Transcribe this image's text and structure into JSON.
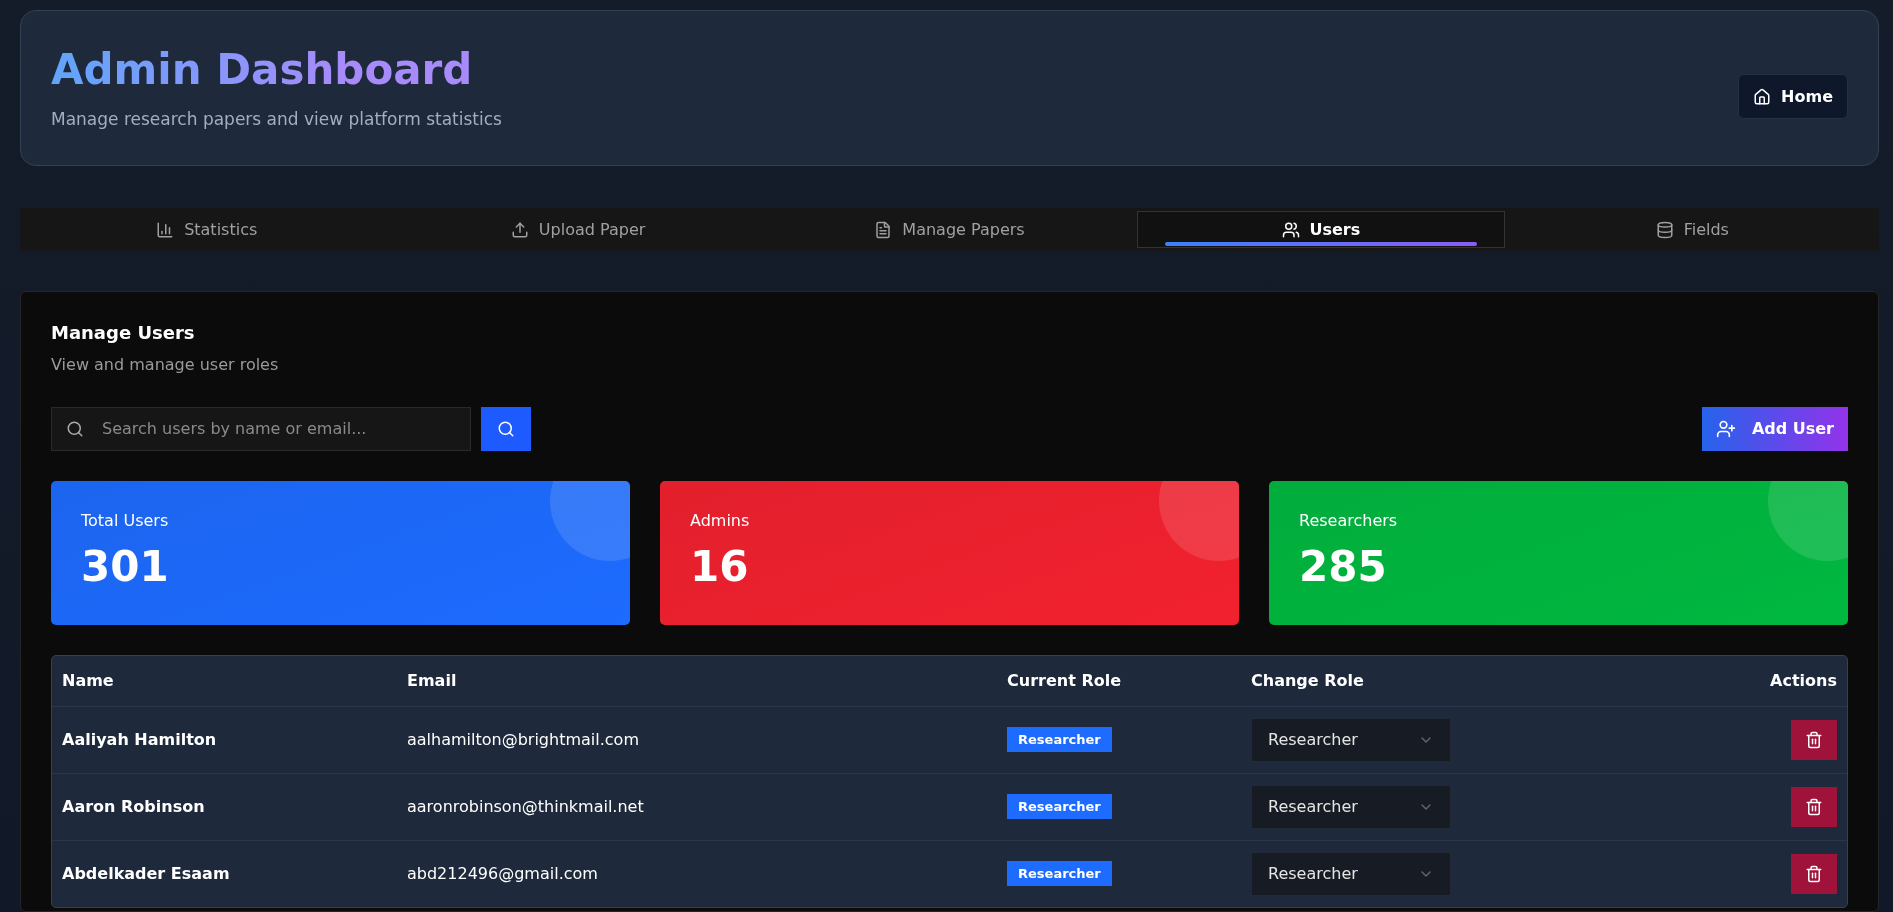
{
  "header": {
    "title": "Admin Dashboard",
    "subtitle": "Manage research papers and view platform statistics",
    "home_button": "Home"
  },
  "tabs": [
    {
      "label": "Statistics",
      "selected": false
    },
    {
      "label": "Upload Paper",
      "selected": false
    },
    {
      "label": "Manage Papers",
      "selected": false
    },
    {
      "label": "Users",
      "selected": true
    },
    {
      "label": "Fields",
      "selected": false
    }
  ],
  "panel": {
    "title": "Manage Users",
    "subtitle": "View and manage user roles",
    "search": {
      "placeholder": "Search users by name or email..."
    },
    "add_button": "Add User"
  },
  "stats": [
    {
      "label": "Total Users",
      "value": "301",
      "color": "#1d6bff"
    },
    {
      "label": "Admins",
      "value": "16",
      "color": "#f2212f"
    },
    {
      "label": "Researchers",
      "value": "285",
      "color": "#00b840"
    }
  ],
  "table": {
    "columns": [
      "Name",
      "Email",
      "Current Role",
      "Change Role",
      "Actions"
    ],
    "rows": [
      {
        "name": "Aaliyah Hamilton",
        "email": "aalhamilton@brightmail.com",
        "role": "Researcher",
        "change_role": "Researcher"
      },
      {
        "name": "Aaron Robinson",
        "email": "aaronrobinson@thinkmail.net",
        "role": "Researcher",
        "change_role": "Researcher"
      },
      {
        "name": "Abdelkader Esaam",
        "email": "abd212496@gmail.com",
        "role": "Researcher",
        "change_role": "Researcher"
      }
    ]
  }
}
